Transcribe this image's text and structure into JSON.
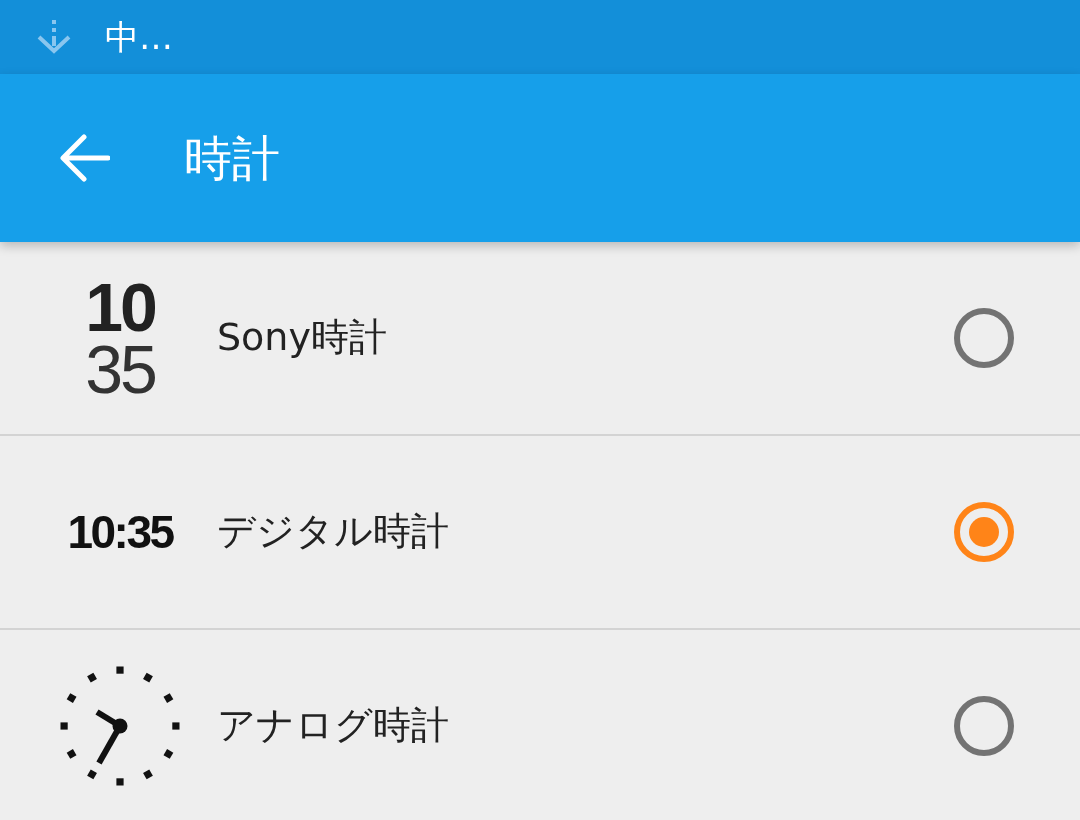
{
  "status_bar": {
    "notification_text": "中…"
  },
  "app_bar": {
    "title": "時計"
  },
  "options": [
    {
      "kind": "stacked",
      "preview": [
        "10",
        "35"
      ],
      "label": "Sony時計",
      "selected": false
    },
    {
      "kind": "digital",
      "preview": [
        "10:35"
      ],
      "label": "デジタル時計",
      "selected": true
    },
    {
      "kind": "analog",
      "label": "アナログ時計",
      "selected": false
    }
  ]
}
